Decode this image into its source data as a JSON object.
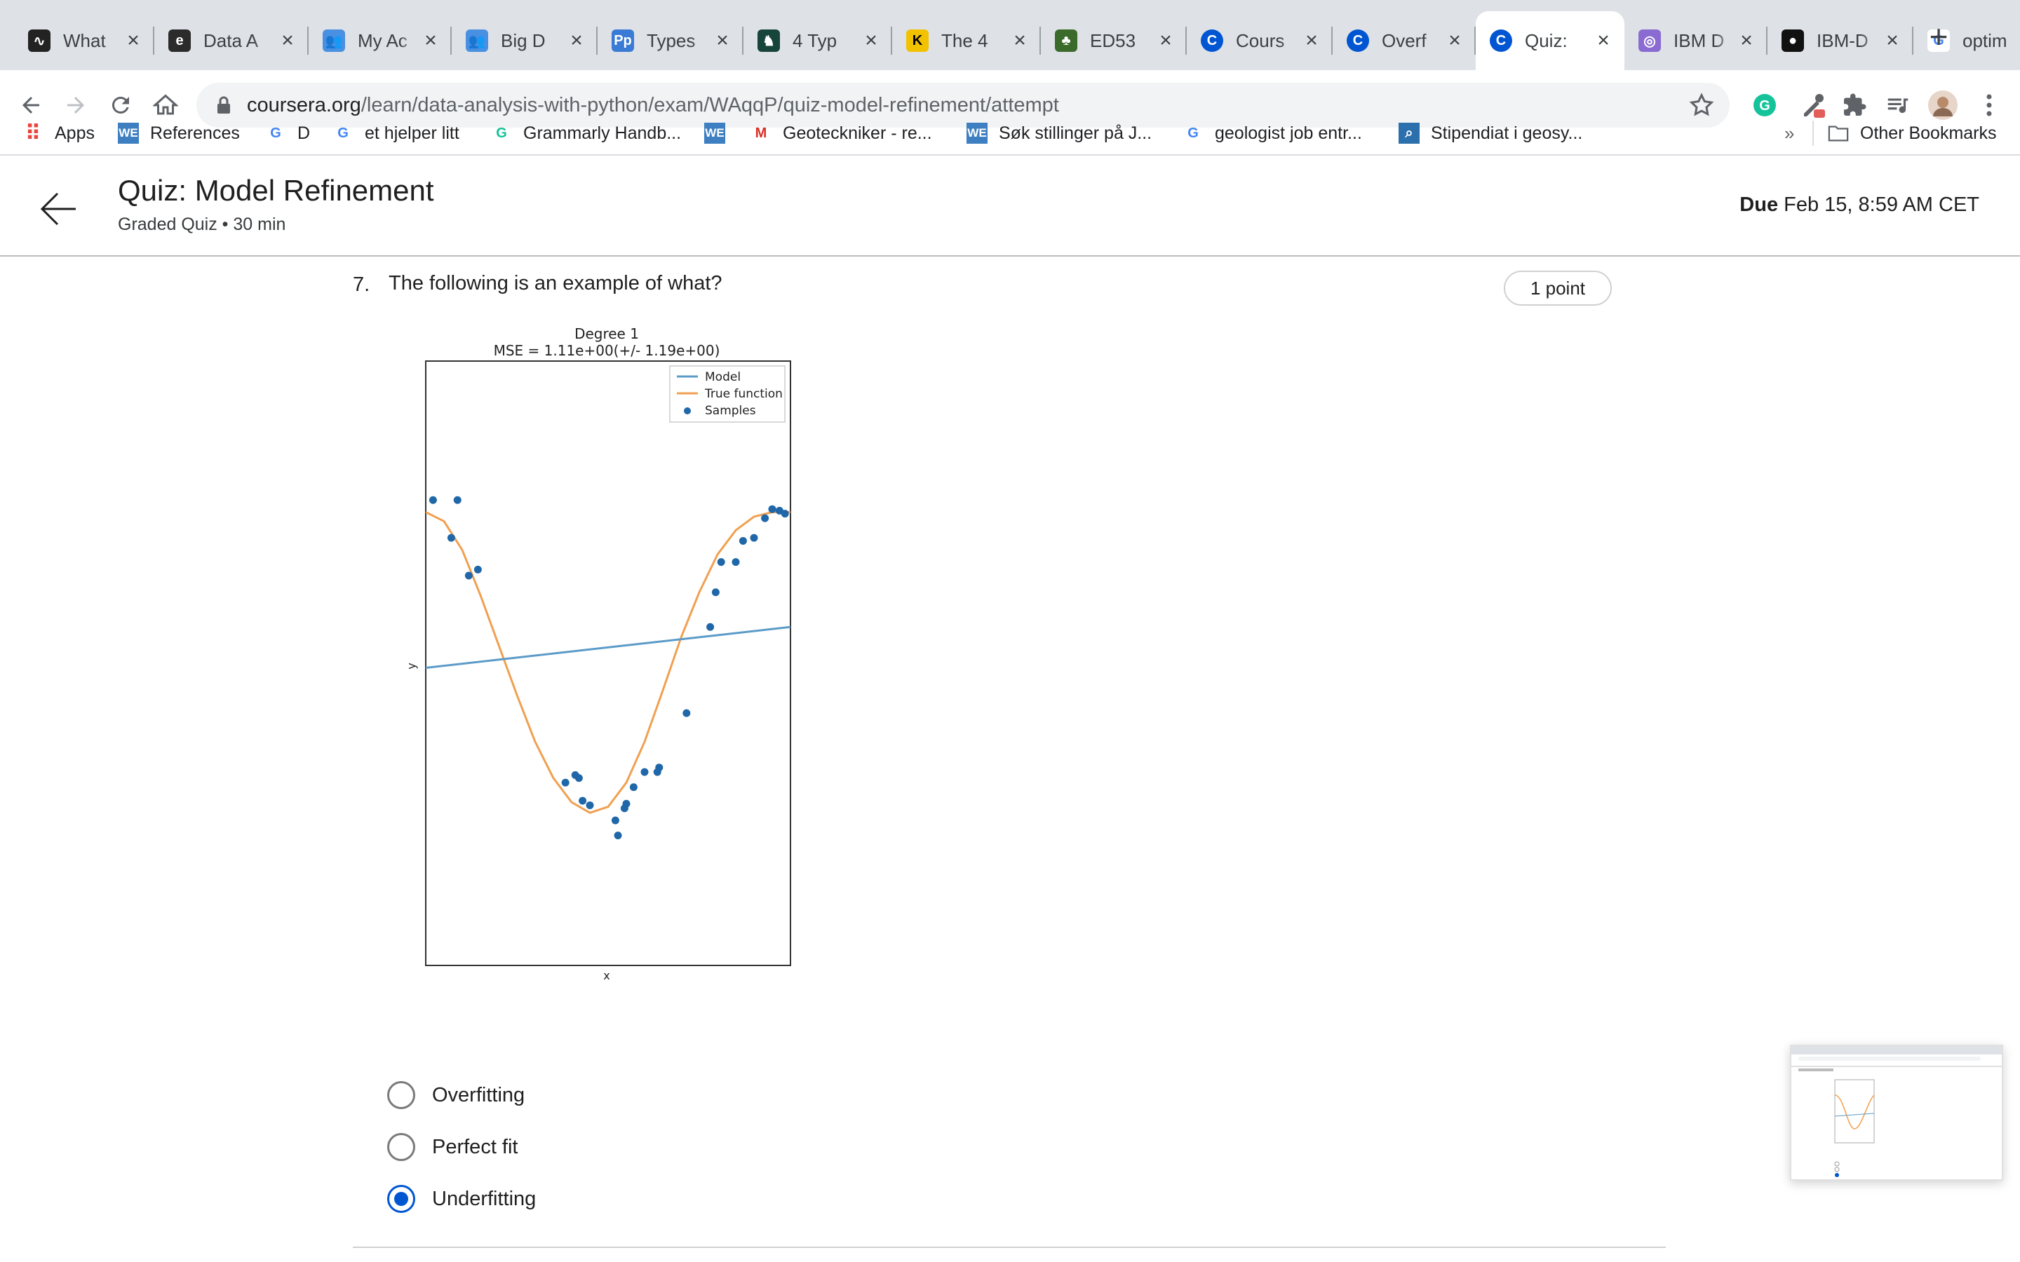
{
  "browser": {
    "tabs": [
      {
        "title": "What",
        "icon": "wave-icon",
        "color": "#222222"
      },
      {
        "title": "Data A",
        "icon": "edge-icon",
        "color": "#2b2b2b"
      },
      {
        "title": "My Ac",
        "icon": "people-icon",
        "color": "#4a90e2"
      },
      {
        "title": "Big D",
        "icon": "people-icon",
        "color": "#4a90e2"
      },
      {
        "title": "Types",
        "icon": "pp-icon",
        "color": "#3a7bd5"
      },
      {
        "title": "4 Typ",
        "icon": "spartan-icon",
        "color": "#18453b"
      },
      {
        "title": "The 4",
        "icon": "k-icon",
        "color": "#f2c200"
      },
      {
        "title": "ED53",
        "icon": "tree-icon",
        "color": "#3b6b2a"
      },
      {
        "title": "Cours",
        "icon": "coursera-icon",
        "color": "#0056d2"
      },
      {
        "title": "Overf",
        "icon": "coursera-icon",
        "color": "#0056d2"
      },
      {
        "title": "Quiz:",
        "icon": "coursera-icon",
        "color": "#0056d2"
      },
      {
        "title": "IBM D",
        "icon": "ibm-icon",
        "color": "#8a6bd1"
      },
      {
        "title": "IBM-D",
        "icon": "github-icon",
        "color": "#111111"
      },
      {
        "title": "optim",
        "icon": "google-icon",
        "color": "#4285f4"
      }
    ],
    "url_domain": "coursera.org",
    "url_path": "/learn/data-analysis-with-python/exam/WAqqP/quiz-model-refinement/attempt",
    "bookmarks": [
      {
        "label": "Apps",
        "icon": "apps-grid-icon"
      },
      {
        "label": "References",
        "icon": "we-icon"
      },
      {
        "label": "D",
        "icon": "google-icon"
      },
      {
        "label": "et hjelper litt",
        "icon": "translate-icon"
      },
      {
        "label": "Grammarly Handb...",
        "icon": "grammarly-icon"
      },
      {
        "label": "",
        "icon": "we-icon"
      },
      {
        "label": "Geoteckniker - re...",
        "icon": "gmail-icon"
      },
      {
        "label": "Søk stillinger på J...",
        "icon": "we-icon"
      },
      {
        "label": "geologist job entr...",
        "icon": "google-icon"
      },
      {
        "label": "Stipendiat i geosy...",
        "icon": "search-box-icon"
      }
    ],
    "more_bookmarks": "»",
    "other_bookmarks": "Other Bookmarks"
  },
  "page": {
    "title": "Quiz: Model Refinement",
    "subtitle": "Graded Quiz • 30 min",
    "due_label": "Due",
    "due_value": "Feb 15, 8:59 AM CET"
  },
  "question": {
    "number": "7.",
    "text": "The following is an example of what?",
    "points": "1 point",
    "options": [
      {
        "label": "Overfitting",
        "selected": false
      },
      {
        "label": "Perfect fit",
        "selected": false
      },
      {
        "label": "Underfitting",
        "selected": true
      }
    ]
  },
  "chart_data": {
    "type": "scatter",
    "title": "Degree 1",
    "subtitle": "MSE = 1.11e+00(+/- 1.19e+00)",
    "xlabel": "x",
    "ylabel": "y",
    "xlim": [
      0,
      1
    ],
    "ylim": [
      -2,
      2
    ],
    "legend": [
      "Model",
      "True function",
      "Samples"
    ],
    "legend_position": "top-right",
    "colors": {
      "model": "#5b9bc8",
      "true_function": "#f0a050",
      "samples": "#1f67a8"
    },
    "series": [
      {
        "name": "Model",
        "type": "line",
        "x": [
          0,
          1
        ],
        "y": [
          -0.03,
          0.24
        ]
      },
      {
        "name": "True function",
        "type": "line",
        "x": [
          0,
          0.05,
          0.1,
          0.15,
          0.2,
          0.25,
          0.3,
          0.35,
          0.4,
          0.45,
          0.5,
          0.55,
          0.6,
          0.65,
          0.7,
          0.75,
          0.8,
          0.85,
          0.9,
          0.95,
          1.0
        ],
        "y": [
          1.0,
          0.94,
          0.75,
          0.45,
          0.12,
          -0.21,
          -0.52,
          -0.76,
          -0.92,
          -0.99,
          -0.95,
          -0.79,
          -0.52,
          -0.18,
          0.17,
          0.47,
          0.72,
          0.88,
          0.97,
          1.0,
          1.0
        ]
      },
      {
        "name": "Samples",
        "type": "scatter",
        "x": [
          0.02,
          0.087,
          0.07,
          0.118,
          0.143,
          0.383,
          0.41,
          0.42,
          0.43,
          0.45,
          0.52,
          0.527,
          0.545,
          0.55,
          0.57,
          0.6,
          0.635,
          0.64,
          0.715,
          0.78,
          0.795,
          0.81,
          0.85,
          0.87,
          0.9,
          0.93,
          0.95,
          0.97,
          0.985
        ],
        "y": [
          1.08,
          1.08,
          0.83,
          0.58,
          0.62,
          -0.79,
          -0.74,
          -0.76,
          -0.91,
          -0.94,
          -1.04,
          -1.14,
          -0.96,
          -0.93,
          -0.82,
          -0.72,
          -0.72,
          -0.69,
          -0.33,
          0.24,
          0.47,
          0.67,
          0.67,
          0.81,
          0.83,
          0.96,
          1.02,
          1.01,
          0.99
        ]
      }
    ]
  }
}
